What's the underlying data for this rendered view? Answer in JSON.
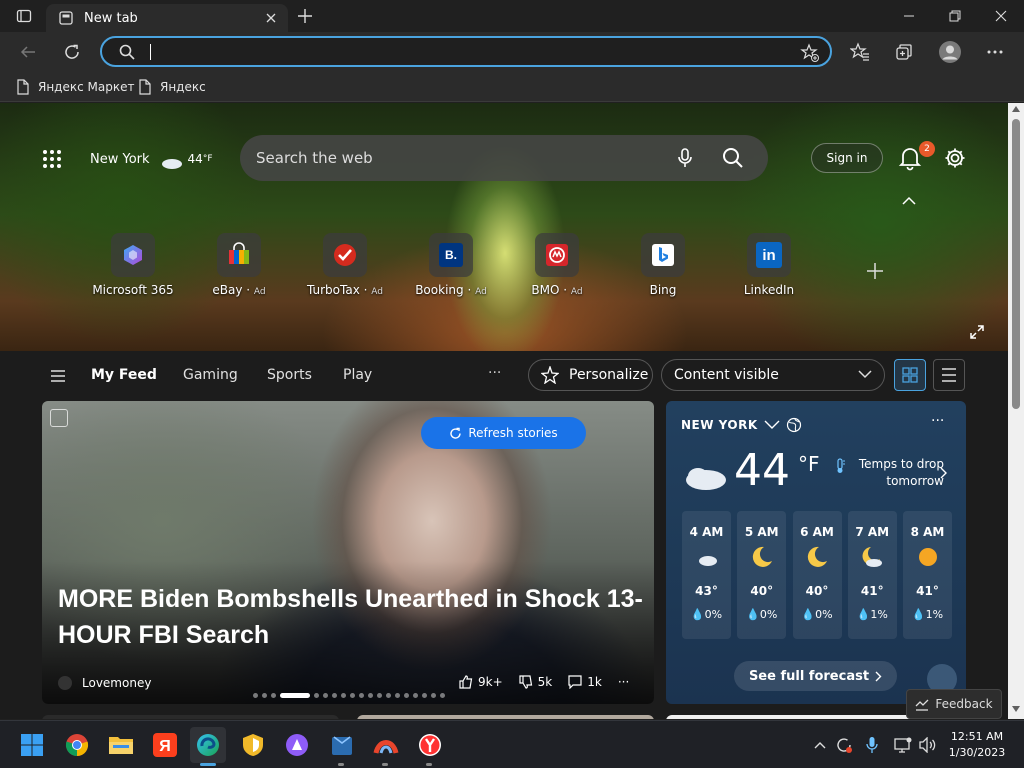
{
  "browser": {
    "tab_title": "New tab",
    "address_value": "",
    "bookmarks": [
      "Яндекс Маркет",
      "Яндекс"
    ]
  },
  "hero": {
    "location": "New York",
    "temperature": "44",
    "temp_unit": "°F",
    "search_placeholder": "Search the web",
    "sign_in": "Sign in",
    "notification_count": "2",
    "quicklinks": [
      {
        "label": "Microsoft 365",
        "ad": "",
        "color": "#6a5acd"
      },
      {
        "label": "eBay",
        "ad": "Ad",
        "color": "#e53238"
      },
      {
        "label": "TurboTax",
        "ad": "Ad",
        "color": "#d52b1e"
      },
      {
        "label": "Booking",
        "ad": "Ad",
        "color": "#003580"
      },
      {
        "label": "BMO",
        "ad": "Ad",
        "color": "#d6262b"
      },
      {
        "label": "Bing",
        "ad": "",
        "color": "#ffffff"
      },
      {
        "label": "LinkedIn",
        "ad": "",
        "color": "#0a66c2"
      }
    ]
  },
  "feed_nav": {
    "items": [
      "My Feed",
      "Gaming",
      "Sports",
      "Play"
    ],
    "more": "···",
    "personalize": "Personalize",
    "content_visible": "Content visible"
  },
  "story": {
    "refresh": "Refresh stories",
    "headline": "MORE Biden Bombshells Unearthed in Shock 13-HOUR FBI Search",
    "source": "Lovemoney",
    "likes": "9k+",
    "dislikes": "5k",
    "comments": "1k",
    "more": "···"
  },
  "weather": {
    "location": "NEW YORK",
    "temperature": "44",
    "unit": "°F",
    "alert": "Temps to drop tomorrow",
    "hours": [
      {
        "time": "4 AM",
        "temp": "43°",
        "precip": "0%",
        "icon": "partly-cloudy-night-icon"
      },
      {
        "time": "5 AM",
        "temp": "40°",
        "precip": "0%",
        "icon": "moon-icon"
      },
      {
        "time": "6 AM",
        "temp": "40°",
        "precip": "0%",
        "icon": "moon-icon"
      },
      {
        "time": "7 AM",
        "temp": "41°",
        "precip": "1%",
        "icon": "partly-cloudy-night-icon"
      },
      {
        "time": "8 AM",
        "temp": "41°",
        "precip": "1%",
        "icon": "sun-icon"
      }
    ],
    "forecast_button": "See full forecast",
    "more": "···"
  },
  "feedback": "Feedback",
  "taskbar": {
    "time": "12:51 AM",
    "date": "1/30/2023"
  },
  "colors": {
    "accent": "#4aa3df",
    "refresh_button": "#1a73e8",
    "badge": "#e8592a"
  }
}
